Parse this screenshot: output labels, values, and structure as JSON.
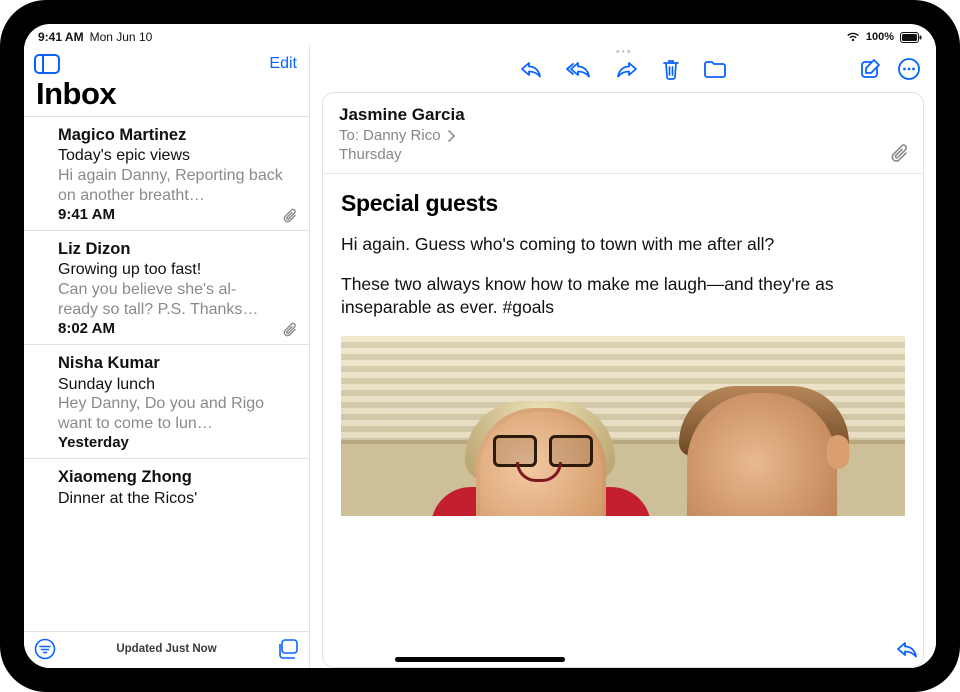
{
  "status": {
    "time": "9:41 AM",
    "date": "Mon Jun 10",
    "battery": "100%"
  },
  "sidebar": {
    "title": "Inbox",
    "edit_label": "Edit",
    "footer_status": "Updated Just Now",
    "items": [
      {
        "sender": "Magico Martinez",
        "subject": "Today's epic views",
        "preview": "Hi again Danny, Reporting back on another breatht…",
        "time": "9:41 AM",
        "has_attachment": true
      },
      {
        "sender": "Liz Dizon",
        "subject": "Growing up too fast!",
        "preview": "Can you believe she's al-\nready so tall? P.S. Thanks…",
        "time": "8:02 AM",
        "has_attachment": true
      },
      {
        "sender": "Nisha Kumar",
        "subject": "Sunday lunch",
        "preview": "Hey Danny, Do you and Rigo want to come to lun…",
        "time": "Yesterday",
        "has_attachment": false
      },
      {
        "sender": "Xiaomeng Zhong",
        "subject": "Dinner at the Ricos'",
        "preview": "",
        "time": "",
        "has_attachment": false
      }
    ]
  },
  "message": {
    "from": "Jasmine Garcia",
    "to_label": "To:",
    "to_name": "Danny Rico",
    "date": "Thursday",
    "has_attachment": true,
    "subject": "Special guests",
    "body": [
      "Hi again. Guess who's coming to town with me after all?",
      "These two always know how to make me laugh—and they're as inseparable as ever. #goals"
    ]
  },
  "icons": {
    "sidebar_toggle": "sidebar-toggle-icon",
    "reply": "reply-icon",
    "reply_all": "reply-all-icon",
    "forward": "forward-icon",
    "trash": "trash-icon",
    "folder": "folder-icon",
    "compose": "compose-icon",
    "more": "more-icon",
    "filter": "filter-icon",
    "mailboxes": "mailboxes-icon",
    "attachment": "paperclip-icon",
    "chevron": "chevron-right-icon",
    "quick_reply": "reply-icon"
  },
  "colors": {
    "accent": "#0a63ff",
    "muted": "#8a8a8e"
  }
}
